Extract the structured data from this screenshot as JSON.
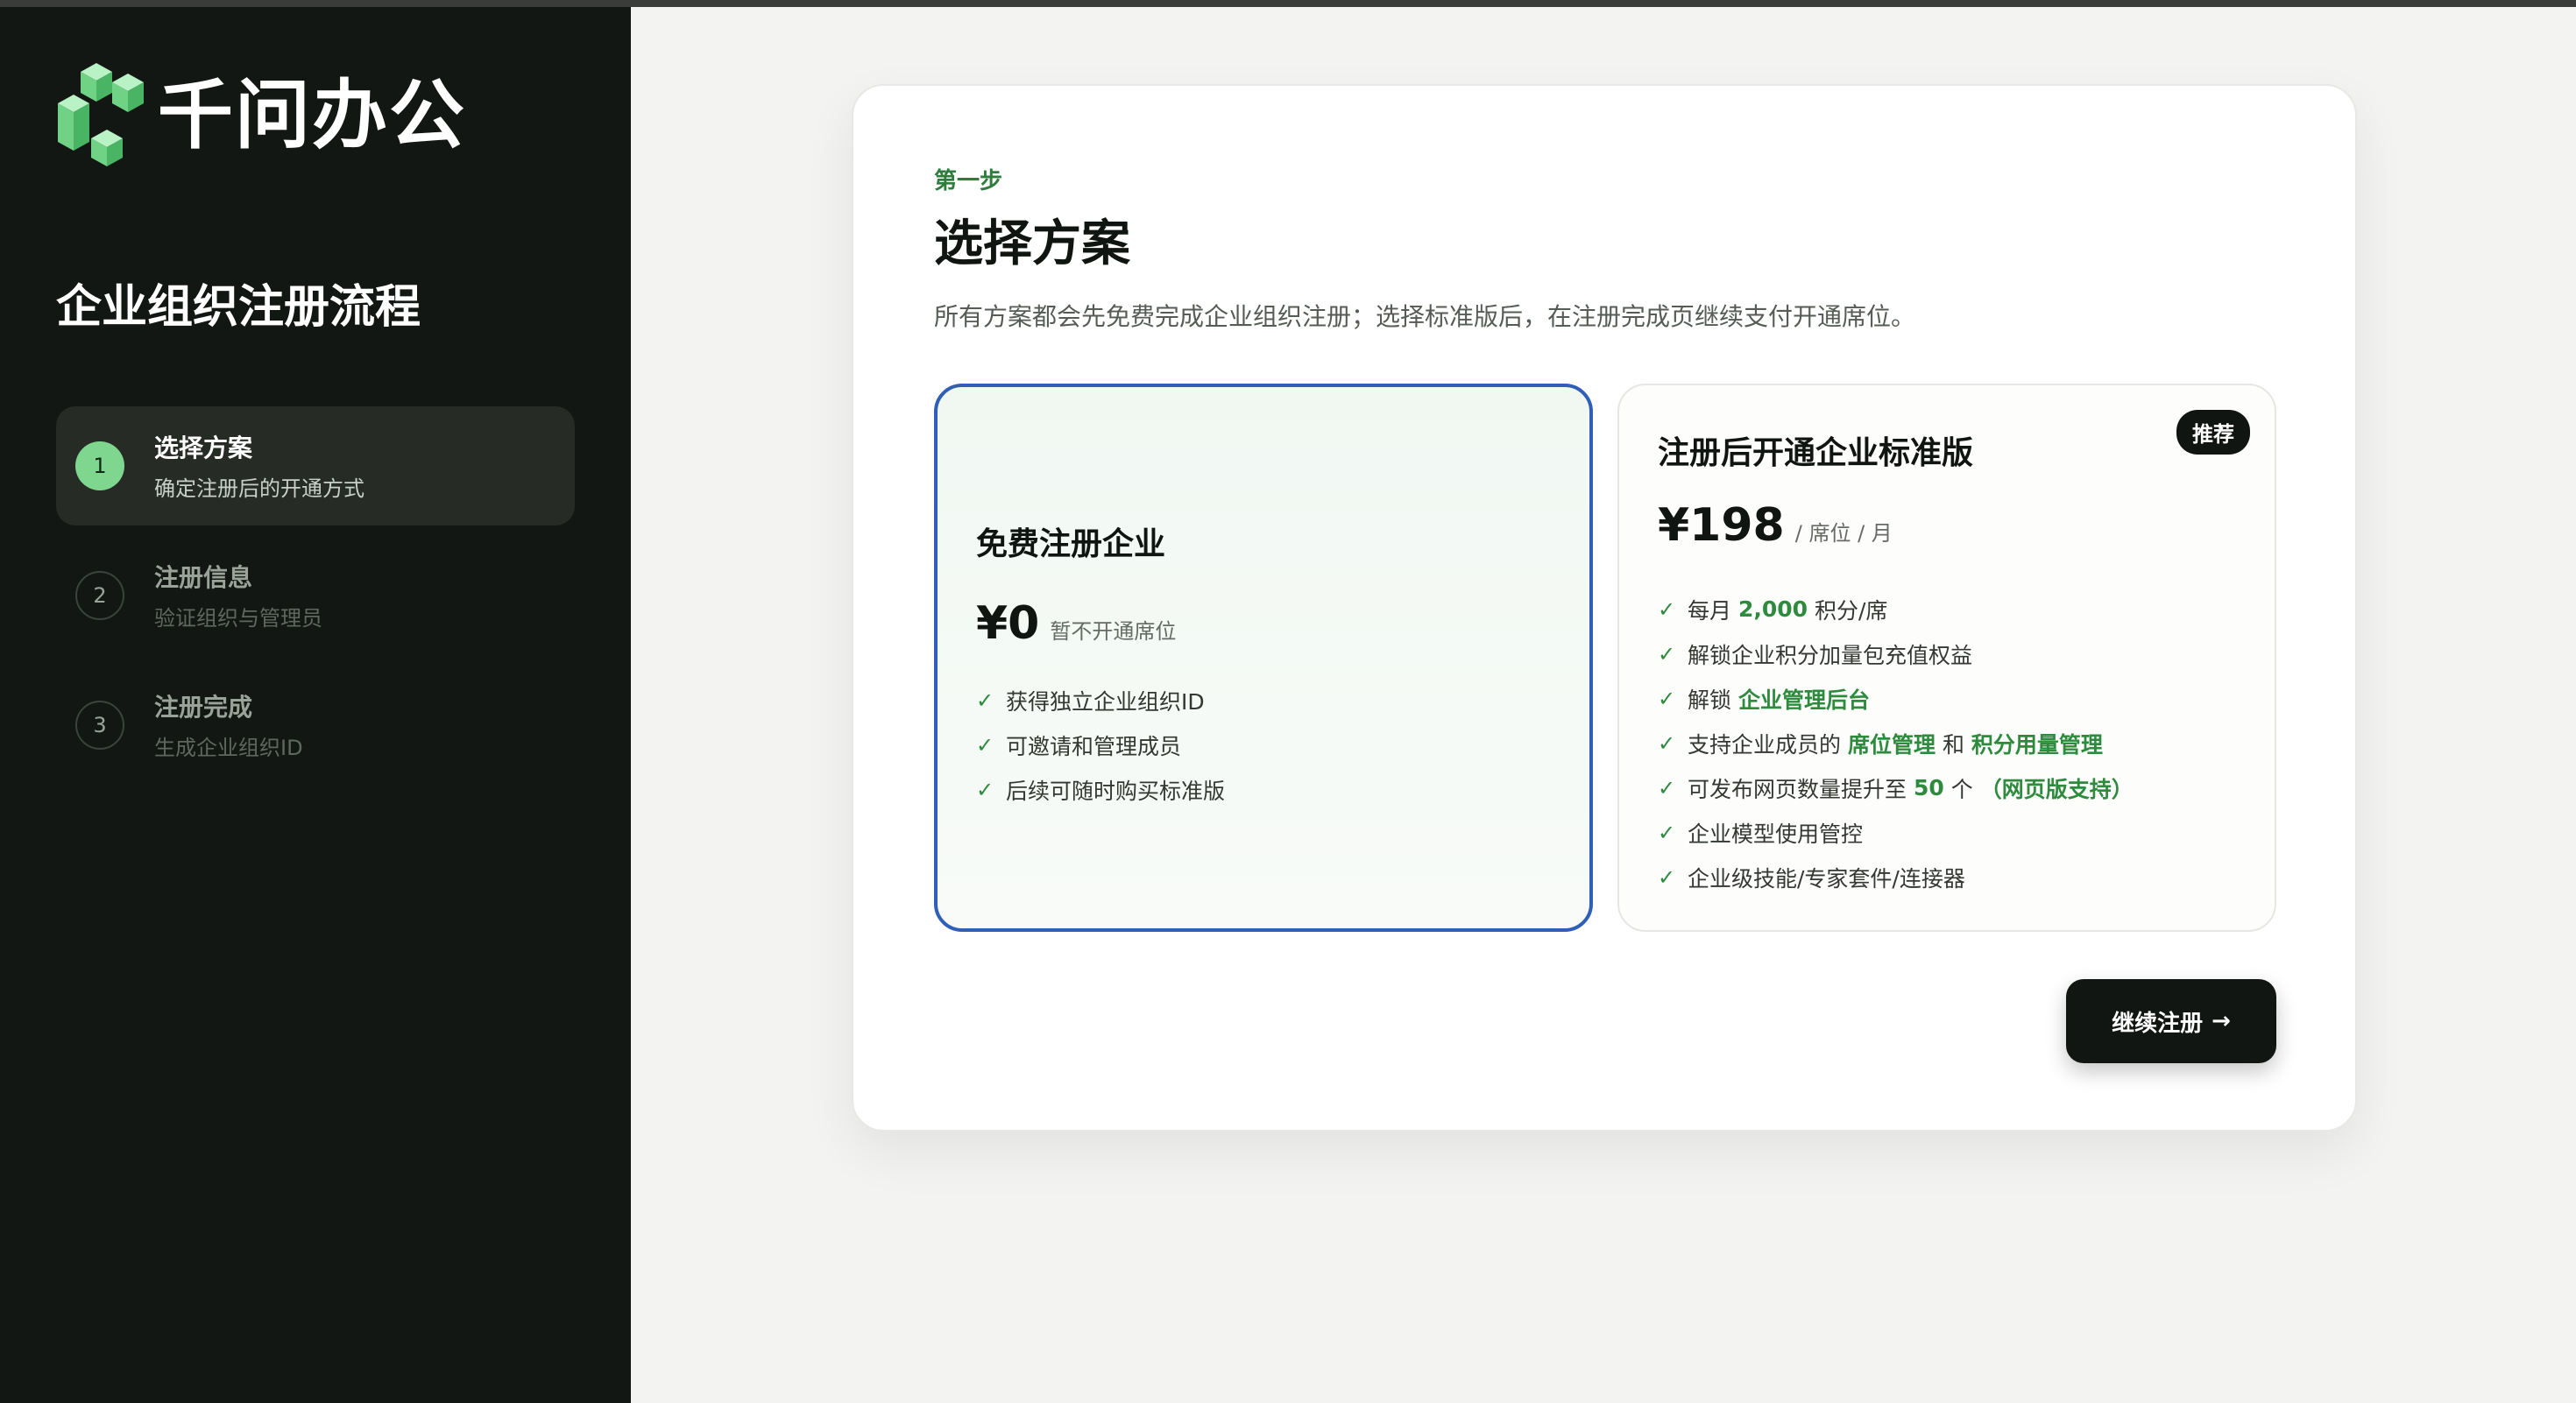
{
  "app": {
    "logo_text": "千问办公"
  },
  "sidebar": {
    "title": "企业组织注册流程",
    "steps": [
      {
        "num": "1",
        "title": "选择方案",
        "subtitle": "确定注册后的开通方式",
        "active": true
      },
      {
        "num": "2",
        "title": "注册信息",
        "subtitle": "验证组织与管理员",
        "active": false
      },
      {
        "num": "3",
        "title": "注册完成",
        "subtitle": "生成企业组织ID",
        "active": false
      }
    ]
  },
  "main": {
    "eyebrow": "第一步",
    "title": "选择方案",
    "description": "所有方案都会先免费完成企业组织注册；选择标准版后，在注册完成页继续支付开通席位。",
    "plans": {
      "free": {
        "name": "免费注册企业",
        "price": "¥0",
        "price_note": "暂不开通席位",
        "features": [
          "获得独立企业组织ID",
          "可邀请和管理成员",
          "后续可随时购买标准版"
        ]
      },
      "standard": {
        "badge": "推荐",
        "name": "注册后开通企业标准版",
        "price": "¥198",
        "price_note": "/ 席位 / 月",
        "f1_a": "每月",
        "f1_b": "2,000",
        "f1_c": "积分/席",
        "f2": "解锁企业积分加量包充值权益",
        "f3_a": "解锁",
        "f3_b": "企业管理后台",
        "f4_a": "支持企业成员的",
        "f4_b": "席位管理",
        "f4_c": "和",
        "f4_d": "积分用量管理",
        "f5_a": "可发布网页数量提升至",
        "f5_b": "50",
        "f5_c": "个",
        "f5_d": "（网页版支持）",
        "f6": "企业模型使用管控",
        "f7": "企业级技能/专家套件/连接器"
      }
    },
    "continue_label": "继续注册",
    "continue_arrow": "→",
    "check_glyph": "✓"
  },
  "colors": {
    "accent_green": "#2e8b3e",
    "selected_border": "#2f5fb8",
    "sidebar_bg": "#131713"
  }
}
